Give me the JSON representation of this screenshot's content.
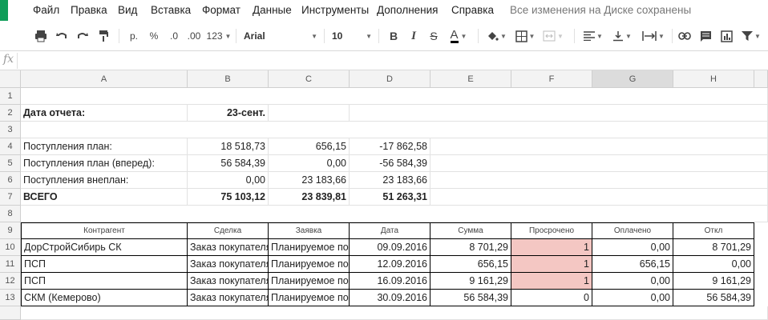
{
  "menu": {
    "items": [
      "Файл",
      "Правка",
      "Вид",
      "Вставка",
      "Формат",
      "Данные",
      "Инструменты",
      "Дополнения",
      "Справка"
    ],
    "status": "Все изменения на Диске сохранены"
  },
  "toolbar": {
    "currency": "р.",
    "percent": "%",
    "dec_less": ".0",
    "dec_more": ".00",
    "more_formats": "123",
    "font": "Arial",
    "font_size": "10",
    "bold": "B",
    "italic": "I",
    "strike": "S",
    "text_color": "A"
  },
  "formula_bar": {
    "fx": "fx",
    "value": ""
  },
  "columns": [
    "A",
    "B",
    "C",
    "D",
    "E",
    "F",
    "G",
    "H"
  ],
  "rows": [
    "1",
    "2",
    "3",
    "4",
    "5",
    "6",
    "7",
    "8",
    "9",
    "10",
    "11",
    "12",
    "13"
  ],
  "report": {
    "date_label": "Дата отчета:",
    "date_value": "23-сент.",
    "lines": [
      {
        "label": "Поступления план:",
        "b": "18 518,73",
        "c": "656,15",
        "d": "-17 862,58"
      },
      {
        "label": "Поступления план (вперед):",
        "b": "56 584,39",
        "c": "0,00",
        "d": "-56 584,39"
      },
      {
        "label": "Поступления внеплан:",
        "b": "0,00",
        "c": "23 183,66",
        "d": "23 183,66"
      }
    ],
    "total": {
      "label": "ВСЕГО",
      "b": "75 103,12",
      "c": "23 839,81",
      "d": "51 263,31"
    }
  },
  "table": {
    "headers": [
      "Контрагент",
      "Сделка",
      "Заявка",
      "Дата",
      "Сумма",
      "Просрочено",
      "Оплачено",
      "Откл"
    ],
    "rows": [
      {
        "contractor": "ДорСтройСибирь СК",
        "deal": "Заказ покупателя",
        "request": "Планируемое поступление",
        "date": "09.09.2016",
        "sum": "8 701,29",
        "overdue": "1",
        "paid": "0,00",
        "dev": "8 701,29",
        "overdue_flag": true
      },
      {
        "contractor": "ПСП",
        "deal": "Заказ покупателя",
        "request": "Планируемое поступление",
        "date": "12.09.2016",
        "sum": "656,15",
        "overdue": "1",
        "paid": "656,15",
        "dev": "0,00",
        "overdue_flag": true
      },
      {
        "contractor": "ПСП",
        "deal": "Заказ покупателя",
        "request": "Планируемое поступление",
        "date": "16.09.2016",
        "sum": "9 161,29",
        "overdue": "1",
        "paid": "0,00",
        "dev": "9 161,29",
        "overdue_flag": true
      },
      {
        "contractor": "СКМ (Кемерово)",
        "deal": "Заказ покупателя",
        "request": "Планируемое поступление",
        "date": "30.09.2016",
        "sum": "56 584,39",
        "overdue": "0",
        "paid": "0,00",
        "dev": "56 584,39",
        "overdue_flag": false
      }
    ]
  },
  "colors": {
    "accent": "#0f9d58",
    "overdue": "#f4c7c3"
  }
}
